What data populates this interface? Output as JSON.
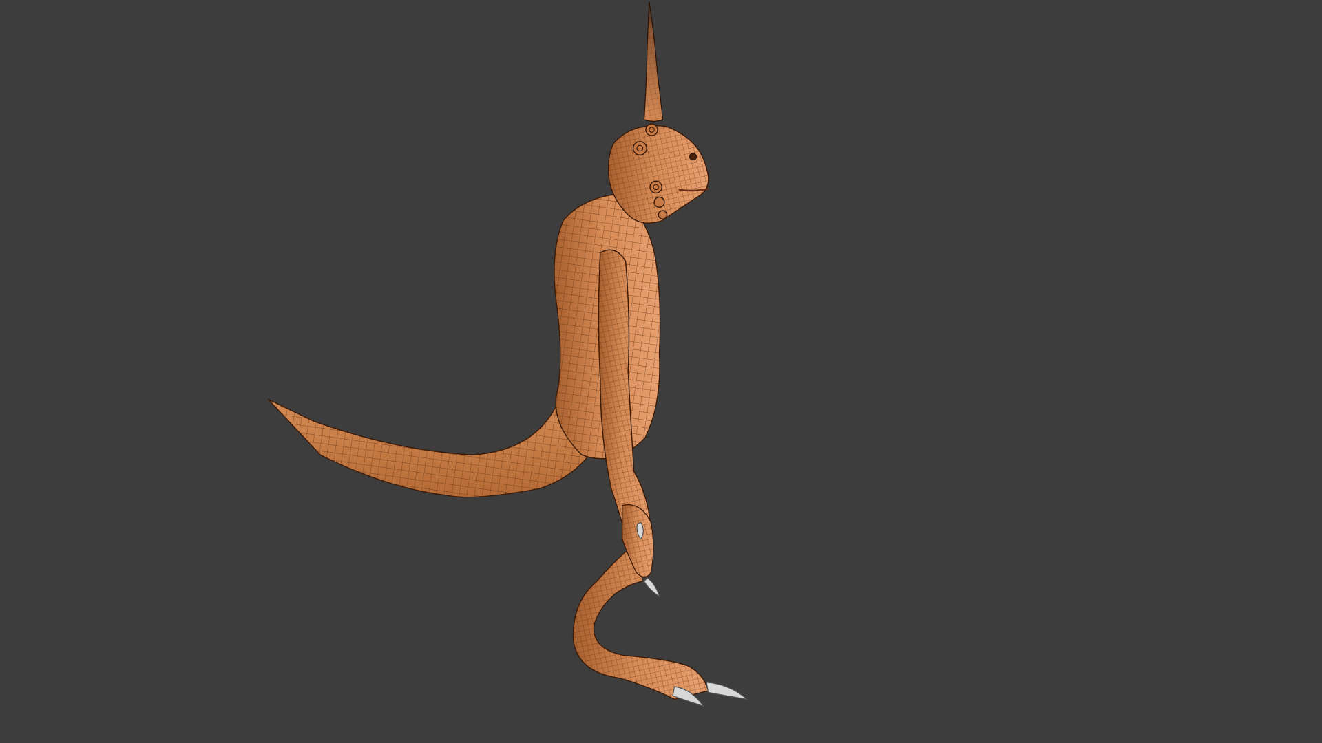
{
  "viewport": {
    "background_color": "#3d3d3d",
    "shading": "solid-wireframe-overlay"
  },
  "model": {
    "subject": "creature-mesh",
    "base_color": "#d68a55",
    "shadow_color": "#a8602f",
    "wire_color": "#5a2e12",
    "claw_color": "#d8d8d8",
    "horn_tip_color": "#1a1a1a"
  }
}
